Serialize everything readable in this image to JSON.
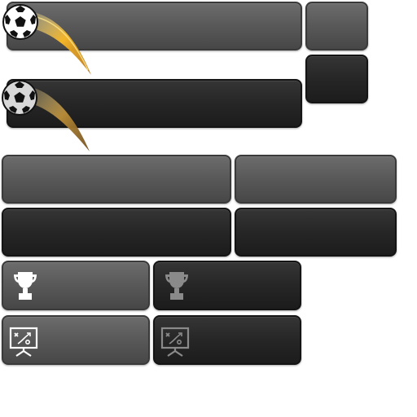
{
  "buttons": {
    "wide_light": {
      "style": "light"
    },
    "wide_dark": {
      "style": "dark"
    },
    "small_light": {
      "style": "light"
    },
    "small_dark": {
      "style": "dark"
    },
    "mid_light_left": {
      "style": "light"
    },
    "mid_light_right": {
      "style": "light"
    },
    "mid_dark_left": {
      "style": "dark"
    },
    "mid_dark_right": {
      "style": "dark"
    },
    "trophy_light": {
      "icon": "trophy-icon",
      "state": "active"
    },
    "trophy_dark": {
      "icon": "trophy-icon",
      "state": "dimmed"
    },
    "tactics_light": {
      "icon": "tactics-board-icon",
      "state": "active"
    },
    "tactics_dark": {
      "icon": "tactics-board-icon",
      "state": "dimmed"
    }
  },
  "icons": {
    "ball": "soccer-ball-icon",
    "trail": "motion-trail"
  },
  "colors": {
    "light_button": "#5a5a5a",
    "dark_button": "#262626",
    "trail_gold": "#e0a020",
    "icon_active": "#ffffff",
    "icon_dimmed": "#8a8a8a"
  }
}
